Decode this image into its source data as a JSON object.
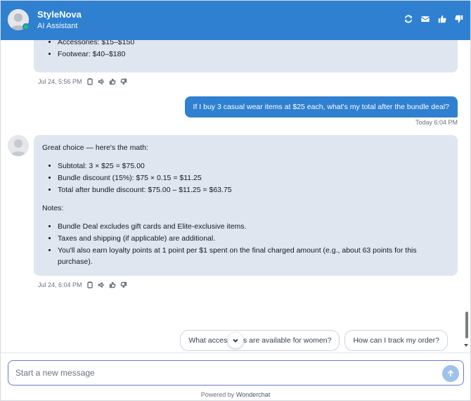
{
  "header": {
    "brand_name": "StyleNova",
    "subtitle": "AI Assistant",
    "icons": [
      "refresh-icon",
      "mail-icon",
      "thumbs-up-icon",
      "thumbs-down-icon"
    ],
    "color": "#2f80d1"
  },
  "messages": {
    "bot1": {
      "items": [
        "Accessories: $15–$150",
        "Footwear: $40–$180"
      ],
      "time": "Jul 24, 5:56 PM"
    },
    "user1": {
      "text": "If I buy 3 casual wear items at $25 each, what's my total after the bundle deal?",
      "time": "Today 6:04 PM"
    },
    "bot2": {
      "intro": "Great choice — here's the math:",
      "math": [
        "Subtotal: 3 × $25 = $75.00",
        "Bundle discount (15%): $75 × 0.15 = $11.25",
        "Total after bundle discount: $75.00 – $11.25 = $63.75"
      ],
      "notes_label": "Notes:",
      "notes": [
        "Bundle Deal excludes gift cards and Elite-exclusive items.",
        "Taxes and shipping (if applicable) are additional.",
        "You'll also earn loyalty points at 1 point per $1 spent on the final charged amount (e.g., about 63 points for this purchase)."
      ],
      "time": "Jul 24, 6:04 PM"
    }
  },
  "suggestions": [
    "What accessories are available for women?",
    "How can I track my order?"
  ],
  "composer": {
    "placeholder": "Start a new message"
  },
  "footer": {
    "powered_by": "Powered by",
    "brand": "Wonderchat"
  }
}
